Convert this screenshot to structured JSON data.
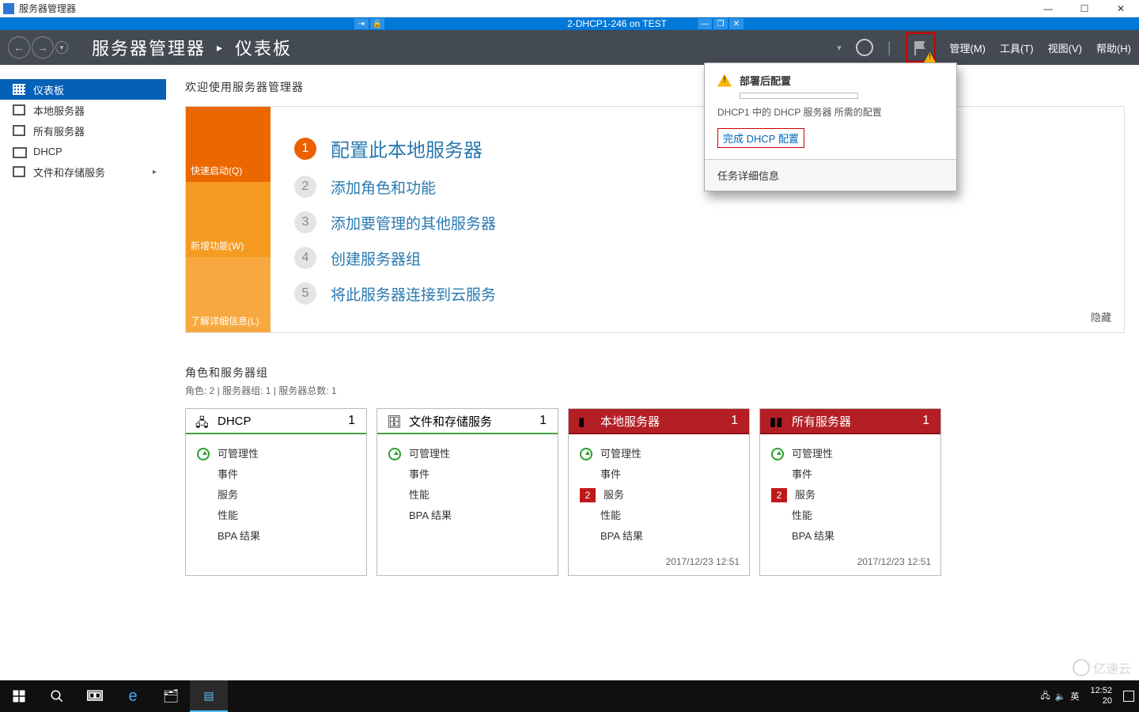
{
  "outer_window": {
    "title": "服务器管理器"
  },
  "vm_bar": {
    "title": "2-DHCP1-246 on TEST"
  },
  "header": {
    "home_label": "服务器管理器",
    "page_label": "仪表板",
    "menus": {
      "manage": "管理(M)",
      "tools": "工具(T)",
      "view": "视图(V)",
      "help": "帮助(H)"
    }
  },
  "flyout": {
    "title": "部署后配置",
    "desc": "DHCP1 中的 DHCP 服务器 所需的配置",
    "link": "完成 DHCP 配置",
    "footer": "任务详细信息"
  },
  "sidebar": {
    "dashboard": "仪表板",
    "local": "本地服务器",
    "all": "所有服务器",
    "dhcp": "DHCP",
    "storage": "文件和存储服务"
  },
  "welcome_title": "欢迎使用服务器管理器",
  "hero": {
    "tab1": "快速启动(Q)",
    "tab2": "新增功能(W)",
    "tab3": "了解详细信息(L)",
    "step1": "配置此本地服务器",
    "step2": "添加角色和功能",
    "step3": "添加要管理的其他服务器",
    "step4": "创建服务器组",
    "step5": "将此服务器连接到云服务",
    "hide": "隐藏"
  },
  "section": {
    "title": "角色和服务器组",
    "sub": "角色: 2 | 服务器组: 1 | 服务器总数: 1"
  },
  "tiles": {
    "row_labels": {
      "manage": "可管理性",
      "events": "事件",
      "services": "服务",
      "perf": "性能",
      "bpa": "BPA 结果"
    },
    "timestamp": "2017/12/23 12:51",
    "t0": {
      "title": "DHCP",
      "count": "1"
    },
    "t1": {
      "title": "文件和存储服务",
      "count": "1"
    },
    "t2": {
      "title": "本地服务器",
      "count": "1",
      "badge": "2"
    },
    "t3": {
      "title": "所有服务器",
      "count": "1",
      "badge": "2"
    }
  },
  "taskbar": {
    "ime": "英",
    "time": "12:52",
    "date_partial": "20"
  },
  "watermark": "亿速云"
}
